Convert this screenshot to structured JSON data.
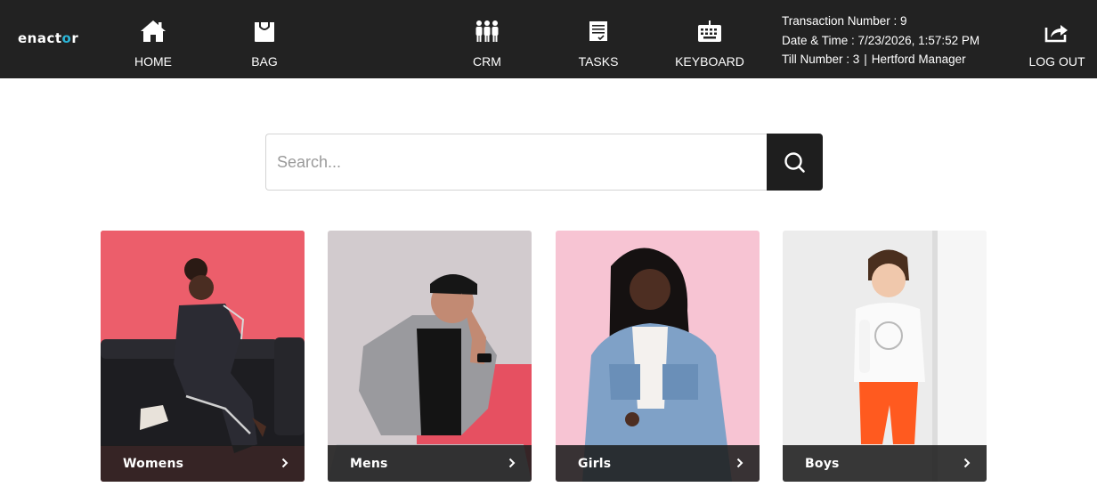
{
  "app": {
    "logo_text_a": "enact",
    "logo_text_o": "o",
    "logo_text_b": "r",
    "accent": "#2bb5d8",
    "topbar_bg": "#222222"
  },
  "nav": {
    "home": {
      "label": "HOME",
      "icon": "home-icon"
    },
    "bag": {
      "label": "BAG",
      "icon": "bag-icon"
    },
    "crm": {
      "label": "CRM",
      "icon": "people-icon"
    },
    "tasks": {
      "label": "TASKS",
      "icon": "tasks-icon"
    },
    "keyboard": {
      "label": "KEYBOARD",
      "icon": "keyboard-icon"
    },
    "logout": {
      "label": "LOG OUT",
      "icon": "logout-icon"
    }
  },
  "transaction": {
    "number_line": "Transaction Number : 9",
    "datetime_line": "Date & Time : 7/23/2026, 1:57:52 PM",
    "till_line": "Till Number : 3",
    "separator": "|",
    "user": "Hertford Manager"
  },
  "search": {
    "placeholder": "Search...",
    "value": "",
    "button_icon": "search-icon"
  },
  "categories": [
    {
      "label": "Womens",
      "bg": "#e14a5c"
    },
    {
      "label": "Mens",
      "bg": "#cfc9cc"
    },
    {
      "label": "Girls",
      "bg": "#f6bfd0"
    },
    {
      "label": "Boys",
      "bg": "#e9e9e9"
    }
  ]
}
